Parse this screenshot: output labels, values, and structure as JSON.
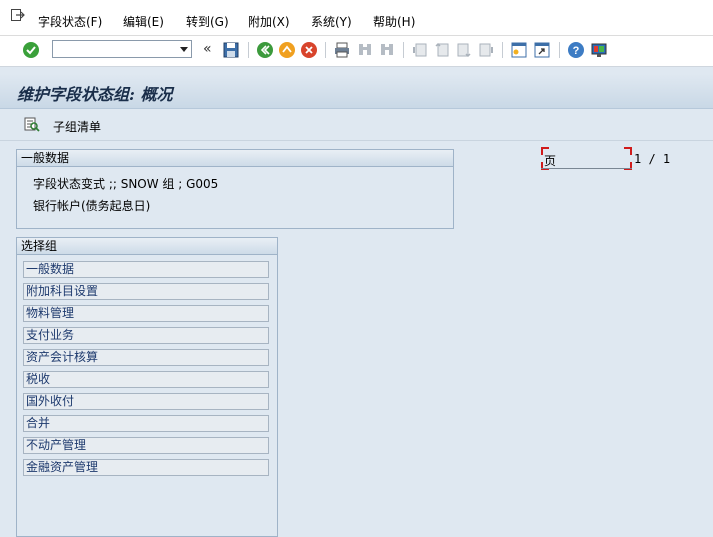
{
  "menubar": {
    "items": [
      "字段状态(F)",
      "编辑(E)",
      "转到(G)",
      "附加(X)",
      "系统(Y)",
      "帮助(H)"
    ]
  },
  "toolbar": {
    "command_field_value": "",
    "icons": [
      "enter-icon",
      "collapse-icon",
      "save-icon",
      "back-icon",
      "exit-icon",
      "cancel-icon",
      "print-icon",
      "find-icon",
      "find-next-icon",
      "first-page-icon",
      "prev-page-icon",
      "next-page-icon",
      "last-page-icon",
      "new-session-icon",
      "shortcut-icon",
      "help-icon",
      "layout-icon"
    ]
  },
  "title": "维护字段状态组: 概况",
  "app_toolbar": {
    "subgroup_list_label": "子组清单"
  },
  "general_data": {
    "header": "一般数据",
    "line1": "字段状态变式 ;; SNOW    组 ; G005",
    "line2": "银行帐户(债务起息日)"
  },
  "page_indicator": {
    "label": "页",
    "value": "1 / 1"
  },
  "select_group": {
    "header": "选择组",
    "items": [
      "一般数据",
      "附加科目设置",
      "物料管理",
      "支付业务",
      "资产会计核算",
      "税收",
      "国外收付",
      "合并",
      "不动产管理",
      "金融资产管理"
    ]
  }
}
